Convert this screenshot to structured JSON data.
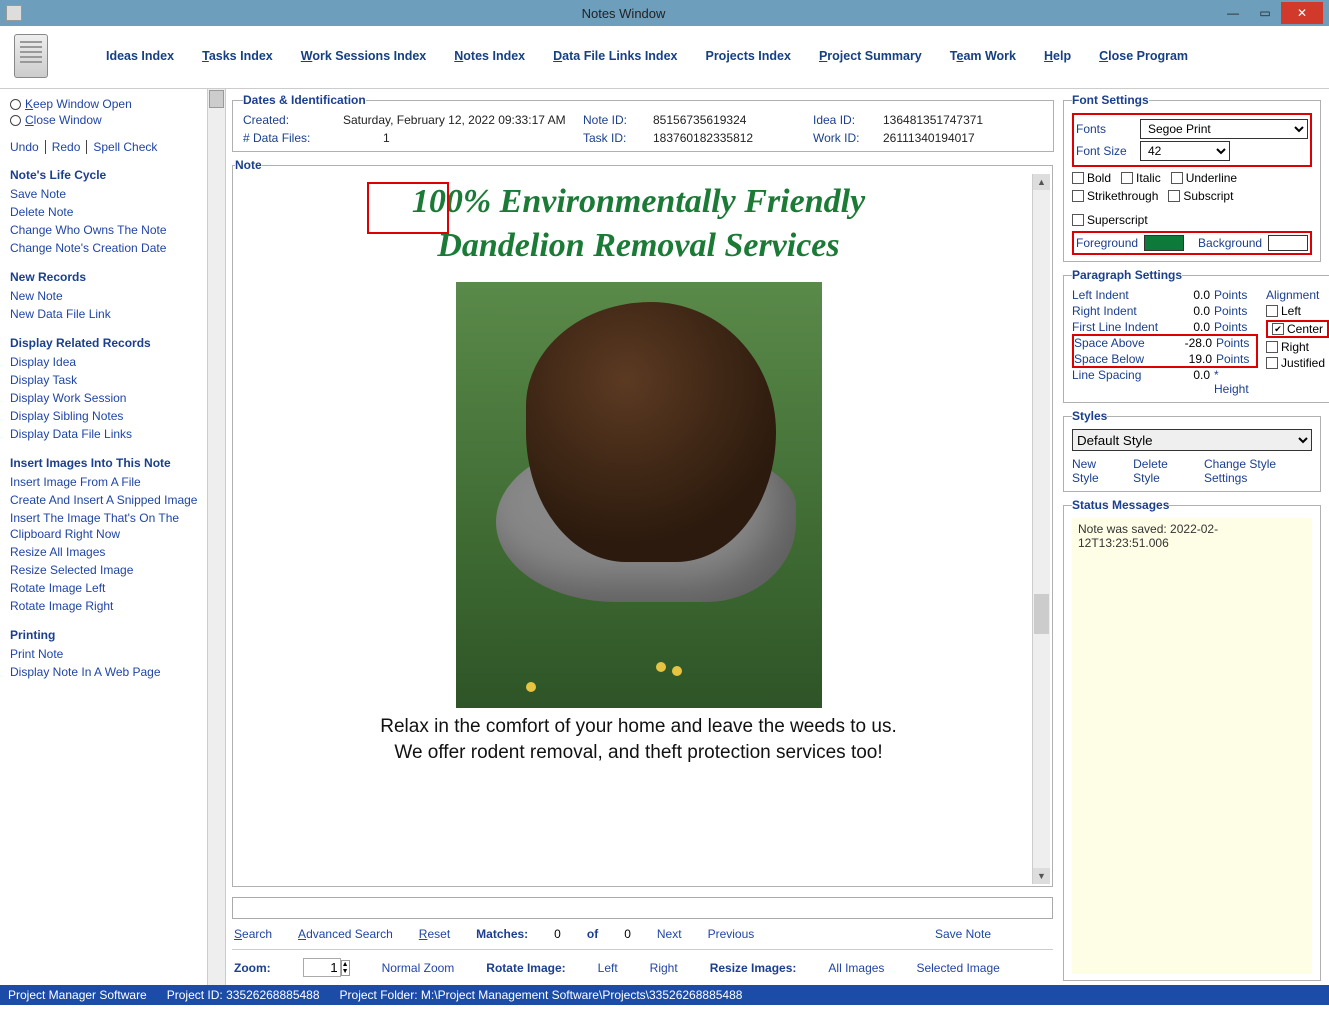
{
  "window": {
    "title": "Notes Window"
  },
  "menu": {
    "ideas": "Ideas Index",
    "tasks": "Tasks Index",
    "work": "Work Sessions Index",
    "notes": "Notes Index",
    "data": "Data File Links Index",
    "projects": "Projects Index",
    "summary": "Project Summary",
    "team": "Team Work",
    "help": "Help",
    "close": "Close Program"
  },
  "left": {
    "keep": "Keep Window Open",
    "closew": "Close Window",
    "undo": "Undo",
    "redo": "Redo",
    "spell": "Spell Check",
    "life_h": "Note's Life Cycle",
    "life": [
      "Save Note",
      "Delete Note",
      "Change Who Owns The Note",
      "Change Note's Creation Date"
    ],
    "new_h": "New Records",
    "newr": [
      "New Note",
      "New Data File Link"
    ],
    "rel_h": "Display Related Records",
    "rel": [
      "Display Idea",
      "Display Task",
      "Display Work Session",
      "Display Sibling Notes",
      "Display Data File Links"
    ],
    "img_h": "Insert Images Into This Note",
    "img": [
      "Insert Image From A File",
      "Create And Insert A Snipped Image",
      "Insert The Image That's On The Clipboard Right Now",
      "Resize All Images",
      "Resize Selected Image",
      "Rotate Image Left",
      "Rotate Image Right"
    ],
    "print_h": "Printing",
    "print": [
      "Print Note",
      "Display Note In A Web Page"
    ]
  },
  "dates": {
    "legend": "Dates & Identification",
    "created_l": "Created:",
    "created_v": "Saturday, February 12, 2022  09:33:17 AM",
    "files_l": "# Data Files:",
    "files_v": "1",
    "note_l": "Note ID:",
    "note_v": "85156735619324",
    "task_l": "Task ID:",
    "task_v": "183760182335812",
    "idea_l": "Idea ID:",
    "idea_v": "136481351747371",
    "work_l": "Work ID:",
    "work_v": "26111340194017"
  },
  "note": {
    "legend": "Note",
    "title1": "100% Environmentally Friendly",
    "title2": "Dandelion Removal Services",
    "sub1": "Relax in the comfort of your home and leave the weeds to us.",
    "sub2": "We offer rodent removal, and theft protection services too!"
  },
  "search": {
    "search": "Search",
    "adv": "Advanced Search",
    "reset": "Reset",
    "matches": "Matches:",
    "m1": "0",
    "of": "of",
    "m2": "0",
    "next": "Next",
    "prev": "Previous",
    "save": "Save Note"
  },
  "zoom": {
    "zoom_l": "Zoom:",
    "zoom_v": "1",
    "normal": "Normal Zoom",
    "rotate_l": "Rotate Image:",
    "left": "Left",
    "right": "Right",
    "resize_l": "Resize Images:",
    "all": "All Images",
    "sel": "Selected Image"
  },
  "font": {
    "legend": "Font Settings",
    "fonts_l": "Fonts",
    "fonts_v": "Segoe Print",
    "size_l": "Font Size",
    "size_v": "42",
    "bold": "Bold",
    "italic": "Italic",
    "underline": "Underline",
    "strike": "Strikethrough",
    "sub": "Subscript",
    "sup": "Superscript",
    "fg_l": "Foreground",
    "fg_v": "#0d7a3a",
    "bg_l": "Background",
    "bg_v": "#ffffff"
  },
  "para": {
    "legend": "Paragraph Settings",
    "li_l": "Left Indent",
    "li_v": "0.0",
    "ri_l": "Right Indent",
    "ri_v": "0.0",
    "fi_l": "First Line Indent",
    "fi_v": "0.0",
    "sa_l": "Space Above",
    "sa_v": "-28.0",
    "sb_l": "Space Below",
    "sb_v": "19.0",
    "ls_l": "Line Spacing",
    "ls_v": "0.0",
    "points": "Points",
    "height": "* Height",
    "align_h": "Alignment",
    "left": "Left",
    "center": "Center",
    "right": "Right",
    "just": "Justified"
  },
  "styles": {
    "legend": "Styles",
    "default": "Default Style",
    "new": "New Style",
    "del": "Delete Style",
    "change": "Change Style Settings"
  },
  "status": {
    "legend": "Status Messages",
    "msg": "Note was saved:  2022-02-12T13:23:51.006"
  },
  "footer": {
    "app": "Project Manager Software",
    "pid_l": "Project ID:",
    "pid_v": "33526268885488",
    "pf_l": "Project Folder:",
    "pf_v": "M:\\Project Management Software\\Projects\\33526268885488"
  }
}
